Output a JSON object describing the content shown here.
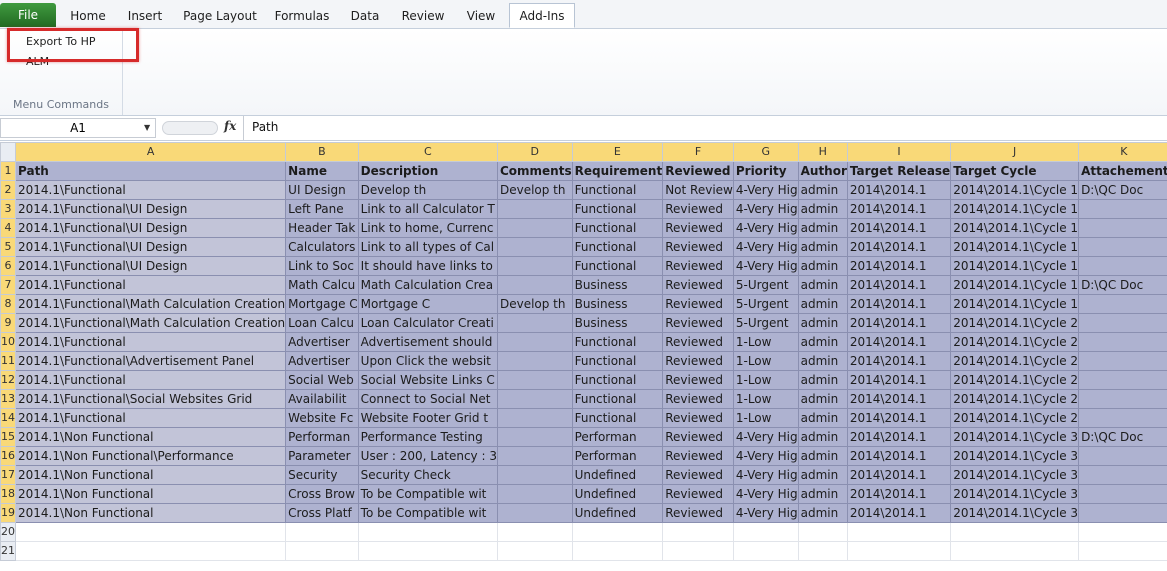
{
  "ribbon": {
    "tabs": [
      "File",
      "Home",
      "Insert",
      "Page Layout",
      "Formulas",
      "Data",
      "Review",
      "View",
      "Add-Ins"
    ],
    "active_tab": "Add-Ins",
    "export_label": "Export To HP ALM",
    "group_label": "Menu Commands"
  },
  "formula_bar": {
    "name_box": "A1",
    "fx": "fx",
    "formula": "Path"
  },
  "grid": {
    "columns": [
      "A",
      "B",
      "C",
      "D",
      "E",
      "F",
      "G",
      "H",
      "I",
      "J",
      "K"
    ],
    "header_row": [
      "Path",
      "Name",
      "Description",
      "Comments",
      "Requirement",
      "Reviewed",
      "Priority",
      "Author",
      "Target Release",
      "Target Cycle",
      "Attachement"
    ],
    "rows": [
      [
        "2014.1\\Functional",
        "UI Design",
        "Develop th",
        "Develop th",
        "Functional",
        "Not Review",
        "4-Very Hig",
        "admin",
        "2014\\2014.1",
        "2014\\2014.1\\Cycle 1",
        "D:\\QC Doc"
      ],
      [
        "2014.1\\Functional\\UI Design",
        "Left Pane",
        "Link to all Calculator T",
        "",
        "Functional",
        "Reviewed",
        "4-Very Hig",
        "admin",
        "2014\\2014.1",
        "2014\\2014.1\\Cycle 1",
        ""
      ],
      [
        "2014.1\\Functional\\UI Design",
        "Header Tak",
        "Link to home, Currenc",
        "",
        "Functional",
        "Reviewed",
        "4-Very Hig",
        "admin",
        "2014\\2014.1",
        "2014\\2014.1\\Cycle 1",
        ""
      ],
      [
        "2014.1\\Functional\\UI Design",
        "Calculators",
        "Link to all types of Cal",
        "",
        "Functional",
        "Reviewed",
        "4-Very Hig",
        "admin",
        "2014\\2014.1",
        "2014\\2014.1\\Cycle 1",
        ""
      ],
      [
        "2014.1\\Functional\\UI Design",
        "Link to Soc",
        "It should have links to",
        "",
        "Functional",
        "Reviewed",
        "4-Very Hig",
        "admin",
        "2014\\2014.1",
        "2014\\2014.1\\Cycle 1",
        ""
      ],
      [
        "2014.1\\Functional",
        "Math Calcu",
        "Math Calculation Crea",
        "",
        "Business",
        "Reviewed",
        "5-Urgent",
        "admin",
        "2014\\2014.1",
        "2014\\2014.1\\Cycle 1",
        "D:\\QC Doc"
      ],
      [
        "2014.1\\Functional\\Math Calculation Creation",
        "Mortgage C",
        "Mortgage C",
        "Develop th",
        "Business",
        "Reviewed",
        "5-Urgent",
        "admin",
        "2014\\2014.1",
        "2014\\2014.1\\Cycle 1",
        ""
      ],
      [
        "2014.1\\Functional\\Math Calculation Creation",
        "Loan Calcu",
        "Loan Calculator Creati",
        "",
        "Business",
        "Reviewed",
        "5-Urgent",
        "admin",
        "2014\\2014.1",
        "2014\\2014.1\\Cycle 2",
        ""
      ],
      [
        "2014.1\\Functional",
        "Advertiser",
        "Advertisement should",
        "",
        "Functional",
        "Reviewed",
        "1-Low",
        "admin",
        "2014\\2014.1",
        "2014\\2014.1\\Cycle 2",
        ""
      ],
      [
        "2014.1\\Functional\\Advertisement Panel",
        "Advertiser",
        "Upon Click the websit",
        "",
        "Functional",
        "Reviewed",
        "1-Low",
        "admin",
        "2014\\2014.1",
        "2014\\2014.1\\Cycle 2",
        ""
      ],
      [
        "2014.1\\Functional",
        "Social Web",
        "Social Website Links C",
        "",
        "Functional",
        "Reviewed",
        "1-Low",
        "admin",
        "2014\\2014.1",
        "2014\\2014.1\\Cycle 2",
        ""
      ],
      [
        "2014.1\\Functional\\Social Websites Grid",
        "Availabilit",
        "Connect to Social Net",
        "",
        "Functional",
        "Reviewed",
        "1-Low",
        "admin",
        "2014\\2014.1",
        "2014\\2014.1\\Cycle 2",
        ""
      ],
      [
        "2014.1\\Functional",
        "Website Fc",
        "Website Footer Grid t",
        "",
        "Functional",
        "Reviewed",
        "1-Low",
        "admin",
        "2014\\2014.1",
        "2014\\2014.1\\Cycle 2",
        ""
      ],
      [
        "2014.1\\Non Functional",
        "Performan",
        "Performance Testing",
        "",
        "Performan",
        "Reviewed",
        "4-Very Hig",
        "admin",
        "2014\\2014.1",
        "2014\\2014.1\\Cycle 3",
        "D:\\QC Doc"
      ],
      [
        "2014.1\\Non Functional\\Performance",
        "Parameter",
        "User : 200, Latency : 3",
        "",
        "Performan",
        "Reviewed",
        "4-Very Hig",
        "admin",
        "2014\\2014.1",
        "2014\\2014.1\\Cycle 3",
        ""
      ],
      [
        "2014.1\\Non Functional",
        "Security",
        "Security Check",
        "",
        "Undefined",
        "Reviewed",
        "4-Very Hig",
        "admin",
        "2014\\2014.1",
        "2014\\2014.1\\Cycle 3",
        ""
      ],
      [
        "2014.1\\Non Functional",
        "Cross Brow",
        "To be Compatible wit",
        "",
        "Undefined",
        "Reviewed",
        "4-Very Hig",
        "admin",
        "2014\\2014.1",
        "2014\\2014.1\\Cycle 3",
        ""
      ],
      [
        "2014.1\\Non Functional",
        "Cross Platf",
        "To be Compatible wit",
        "",
        "Undefined",
        "Reviewed",
        "4-Very Hig",
        "admin",
        "2014\\2014.1",
        "2014\\2014.1\\Cycle 3",
        ""
      ]
    ],
    "extra_rows": [
      "20",
      "21"
    ]
  }
}
